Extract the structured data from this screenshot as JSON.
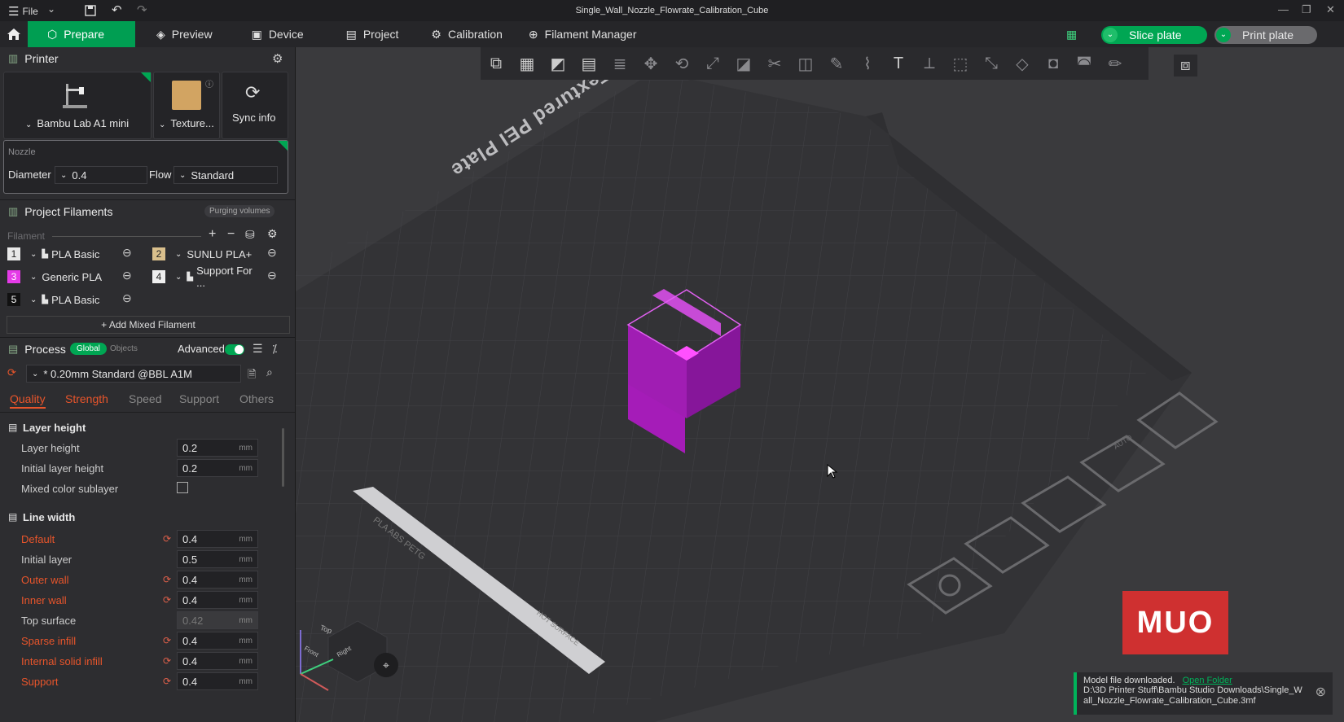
{
  "window": {
    "title": "Single_Wall_Nozzle_Flowrate_Calibration_Cube",
    "file_menu": "File"
  },
  "tabs": [
    {
      "label": "Prepare",
      "icon": "cube-icon"
    },
    {
      "label": "Preview",
      "icon": "layers-icon"
    },
    {
      "label": "Device",
      "icon": "device-icon"
    },
    {
      "label": "Project",
      "icon": "project-icon"
    },
    {
      "label": "Calibration",
      "icon": "calibration-icon"
    },
    {
      "label": "Filament Manager",
      "icon": "filament-icon"
    }
  ],
  "actions": {
    "slice": "Slice plate",
    "print": "Print plate"
  },
  "printer": {
    "header": "Printer",
    "model": "Bambu Lab A1 mini",
    "plate": "Texture...",
    "sync": "Sync info",
    "nozzle_label": "Nozzle",
    "diameter_label": "Diameter",
    "diameter": "0.4",
    "flow_label": "Flow",
    "flow": "Standard"
  },
  "filaments": {
    "header": "Project Filaments",
    "purging": "Purging volumes",
    "filament_label": "Filament",
    "items": [
      {
        "num": "1",
        "name": "PLA Basic",
        "color": "#e8e8e8"
      },
      {
        "num": "2",
        "name": "SUNLU PLA+",
        "color": "#d9bf8c"
      },
      {
        "num": "3",
        "name": "Generic PLA",
        "color": "#e53be8"
      },
      {
        "num": "4",
        "name": "Support For ...",
        "color": "#efefef"
      },
      {
        "num": "5",
        "name": "PLA Basic",
        "color": "#111111"
      }
    ],
    "add_mixed": "Add Mixed Filament"
  },
  "process": {
    "header": "Process",
    "global": "Global",
    "objects": "Objects",
    "advanced": "Advanced",
    "preset": "* 0.20mm Standard @BBL A1M",
    "subtabs": [
      "Quality",
      "Strength",
      "Speed",
      "Support",
      "Others"
    ]
  },
  "settings": {
    "layer_height_group": "Layer height",
    "layer_height": {
      "label": "Layer height",
      "value": "0.2"
    },
    "initial_layer_height": {
      "label": "Initial layer height",
      "value": "0.2"
    },
    "mixed_color": {
      "label": "Mixed color sublayer"
    },
    "line_width_group": "Line width",
    "default": {
      "label": "Default",
      "value": "0.4"
    },
    "initial_layer": {
      "label": "Initial layer",
      "value": "0.5"
    },
    "outer_wall": {
      "label": "Outer wall",
      "value": "0.4"
    },
    "inner_wall": {
      "label": "Inner wall",
      "value": "0.4"
    },
    "top_surface": {
      "label": "Top surface",
      "value": "0.42"
    },
    "sparse_infill": {
      "label": "Sparse infill",
      "value": "0.4"
    },
    "internal_solid": {
      "label": "Internal solid infill",
      "value": "0.4"
    },
    "support": {
      "label": "Support",
      "value": "0.4"
    },
    "unit": "mm"
  },
  "plate": {
    "name": "Bambu Textured PEI Plate",
    "side_label": "PLA ABS PETG",
    "hot_label": "HOT SURFACE",
    "auto_label": "AUTO",
    "cube_top": "Top",
    "cube_front": "Front",
    "cube_right": "Right"
  },
  "watermark": "MUO",
  "toast": {
    "message": "Model file downloaded.",
    "link": "Open Folder",
    "path": "D:\\3D Printer Stuff\\Bambu Studio Downloads\\Single_Wall_Nozzle_Flowrate_Calibration_Cube.3mf"
  },
  "colors": {
    "accent": "#009e52",
    "modified": "#e8552b",
    "object": "#b21fc4"
  }
}
